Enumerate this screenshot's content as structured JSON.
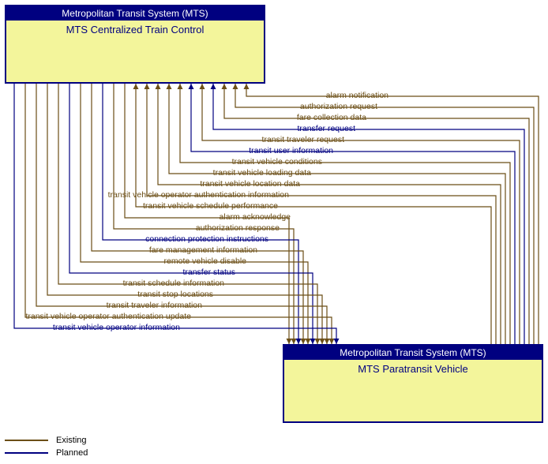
{
  "nodes": {
    "top": {
      "header": "Metropolitan Transit System (MTS)",
      "body": "MTS Centralized Train Control"
    },
    "bottom": {
      "header": "Metropolitan Transit System (MTS)",
      "body": "MTS Paratransit Vehicle"
    }
  },
  "legend": {
    "existing": "Existing",
    "planned": "Planned"
  },
  "flows_incoming": [
    {
      "label": "alarm notification",
      "status": "existing"
    },
    {
      "label": "authorization request",
      "status": "existing"
    },
    {
      "label": "fare collection data",
      "status": "existing"
    },
    {
      "label": "transfer request",
      "status": "planned"
    },
    {
      "label": "transit traveler request",
      "status": "existing"
    },
    {
      "label": "transit user information",
      "status": "planned"
    },
    {
      "label": "transit vehicle conditions",
      "status": "existing"
    },
    {
      "label": "transit vehicle loading data",
      "status": "existing"
    },
    {
      "label": "transit vehicle location data",
      "status": "existing"
    },
    {
      "label": "transit vehicle operator authentication information",
      "status": "existing"
    },
    {
      "label": "transit vehicle schedule performance",
      "status": "existing"
    }
  ],
  "flows_outgoing": [
    {
      "label": "alarm acknowledge",
      "status": "existing"
    },
    {
      "label": "authorization response",
      "status": "existing"
    },
    {
      "label": "connection protection instructions",
      "status": "planned"
    },
    {
      "label": "fare management information",
      "status": "existing"
    },
    {
      "label": "remote vehicle disable",
      "status": "existing"
    },
    {
      "label": "transfer status",
      "status": "planned"
    },
    {
      "label": "transit schedule information",
      "status": "existing"
    },
    {
      "label": "transit stop locations",
      "status": "existing"
    },
    {
      "label": "transit traveler information",
      "status": "existing"
    },
    {
      "label": "transit vehicle operator authentication update",
      "status": "existing"
    },
    {
      "label": "transit vehicle operator information",
      "status": "planned"
    }
  ],
  "colors": {
    "existing": "#6b4e16",
    "planned": "#000080"
  }
}
